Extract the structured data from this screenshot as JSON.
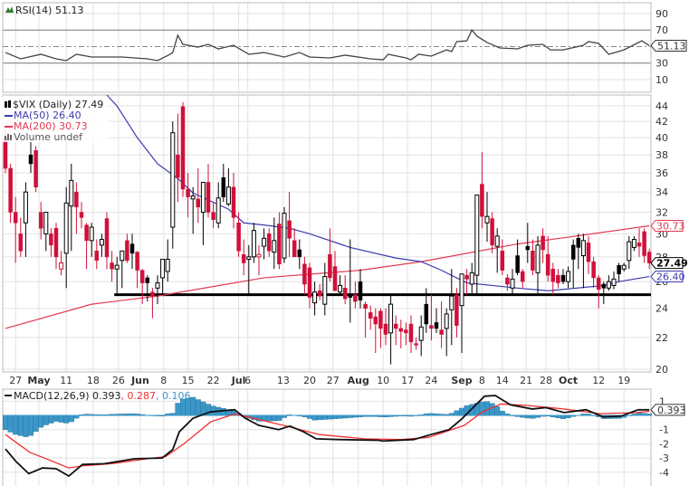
{
  "colors": {
    "down": "#d0103a",
    "up": "#000000",
    "ma50": "#3b3bb0",
    "ma200": "#e23a50",
    "hist": "#3a97c9",
    "macd": "#111111",
    "signal": "#f03030",
    "grid": "#e2e2e2"
  },
  "rsi": {
    "label": "RSI(14) 51.13",
    "badge": "51.13",
    "ticks": [
      "90",
      "70",
      "50",
      "30",
      "10"
    ]
  },
  "price": {
    "title": "$VIX (Daily) 27.49",
    "ma50_label": "MA(50) 26.40",
    "ma200_label": "MA(200) 30.73",
    "volume_label": "Volume undef",
    "badge_close": "27.49",
    "badge_ma50": "26.40",
    "badge_ma200": "30.73",
    "ticks": [
      "44",
      "42",
      "40",
      "38",
      "36",
      "34",
      "32",
      "30",
      "28",
      "26",
      "24",
      "22",
      "20"
    ]
  },
  "macd": {
    "label_main": "MACD(12,26,9) 0.393",
    "label_signal": ", 0.287",
    "label_hist": ", 0.106",
    "badge": "0.393",
    "ticks": [
      "1",
      "-1",
      "-2",
      "-3",
      "-4"
    ]
  },
  "x_labels": [
    {
      "t": "27",
      "i": 2
    },
    {
      "t": "May",
      "i": 6.6,
      "b": 1
    },
    {
      "t": "11",
      "i": 12
    },
    {
      "t": "18",
      "i": 17.3
    },
    {
      "t": "26",
      "i": 22.3
    },
    {
      "t": "Jun",
      "i": 26.6,
      "b": 1
    },
    {
      "t": "8",
      "i": 31.2
    },
    {
      "t": "15",
      "i": 36
    },
    {
      "t": "22",
      "i": 41
    },
    {
      "t": "Jul",
      "i": 46,
      "b": 1
    },
    {
      "t": "6",
      "i": 47.8
    },
    {
      "t": "13",
      "i": 54.8
    },
    {
      "t": "20",
      "i": 60
    },
    {
      "t": "27",
      "i": 64.6
    },
    {
      "t": "Aug",
      "i": 69.6,
      "b": 1
    },
    {
      "t": "10",
      "i": 74.5
    },
    {
      "t": "17",
      "i": 79.3
    },
    {
      "t": "24",
      "i": 84
    },
    {
      "t": "Sep",
      "i": 90,
      "b": 1
    },
    {
      "t": "8",
      "i": 94
    },
    {
      "t": "14",
      "i": 98
    },
    {
      "t": "21",
      "i": 102.7
    },
    {
      "t": "28",
      "i": 106.6
    },
    {
      "t": "Oct",
      "i": 111,
      "b": 1
    },
    {
      "t": "12",
      "i": 117
    },
    {
      "t": "19",
      "i": 122
    }
  ],
  "chart_data": {
    "type": "candlestick",
    "title": "$VIX (Daily)",
    "yscale": "log",
    "ylim": [
      20,
      44
    ],
    "support_level": {
      "value": 25.0,
      "from_index": 22
    },
    "ohlc": [
      [
        40,
        41,
        36,
        36.5
      ],
      [
        36.5,
        37,
        31,
        32
      ],
      [
        32,
        33.5,
        27.5,
        31
      ],
      [
        30,
        31.5,
        28,
        28.5
      ],
      [
        31,
        35,
        28,
        34
      ],
      [
        38,
        39.5,
        36,
        37
      ],
      [
        38.5,
        39,
        34,
        34.5
      ],
      [
        32,
        33,
        29.5,
        30.5
      ],
      [
        30,
        32,
        28.5,
        32
      ],
      [
        30,
        30.5,
        28,
        29
      ],
      [
        30.5,
        31,
        27,
        28
      ],
      [
        27,
        28.5,
        26.5,
        27.5
      ],
      [
        28.3,
        34.5,
        25.5,
        32.9
      ],
      [
        32.6,
        37,
        28.5,
        35.2
      ],
      [
        34,
        35,
        30,
        32.5
      ],
      [
        32,
        33,
        30.5,
        31.5
      ],
      [
        30.8,
        31,
        27,
        29.4
      ],
      [
        29.4,
        31,
        28,
        30.6
      ],
      [
        28.5,
        29.5,
        27,
        27.7
      ],
      [
        29,
        30,
        28,
        29.5
      ],
      [
        31.4,
        32,
        27,
        28
      ],
      [
        27.5,
        28.5,
        26,
        27
      ],
      [
        27,
        28,
        25,
        27.3
      ],
      [
        27.7,
        28,
        25.5,
        28.5
      ],
      [
        29.4,
        30,
        27.5,
        27.7
      ],
      [
        29.1,
        30,
        27,
        28.3
      ],
      [
        28.4,
        28.5,
        25.5,
        26.9
      ],
      [
        26.9,
        27,
        24.3,
        25.9
      ],
      [
        26.3,
        26.5,
        24.5,
        25.9
      ],
      [
        25.2,
        25.5,
        23.3,
        24.9
      ],
      [
        25.5,
        26.5,
        24.3,
        25.9
      ],
      [
        26.3,
        27.5,
        25,
        27.8
      ],
      [
        26.8,
        29.5,
        26,
        27.8
      ],
      [
        30.6,
        42,
        28.7,
        40.6
      ],
      [
        38,
        43,
        33,
        35.5
      ],
      [
        43.9,
        44.5,
        33.5,
        34.3
      ],
      [
        34.3,
        36,
        31.5,
        33.5
      ],
      [
        33.3,
        34.5,
        30,
        33.6
      ],
      [
        33.3,
        36.5,
        31,
        32.5
      ],
      [
        32,
        35,
        29,
        35
      ],
      [
        35,
        37,
        31.5,
        32
      ],
      [
        32,
        33,
        30.5,
        31.3
      ],
      [
        31,
        35,
        30.5,
        33.4
      ],
      [
        35.5,
        37,
        33,
        33.5
      ],
      [
        32.8,
        36.5,
        32.6,
        34.5
      ],
      [
        34.5,
        36,
        30.5,
        31.5
      ],
      [
        31,
        32,
        28,
        28.5
      ],
      [
        28.2,
        29.5,
        26.5,
        27.5
      ],
      [
        27.8,
        29,
        25,
        28
      ],
      [
        28,
        31,
        27.5,
        30.3
      ],
      [
        28,
        29,
        26.5,
        28.2
      ],
      [
        28.9,
        30.5,
        27.8,
        29.6
      ],
      [
        30,
        30.5,
        28,
        28.5
      ],
      [
        28.4,
        31.5,
        27,
        29.4
      ],
      [
        30.9,
        32,
        27,
        27.4
      ],
      [
        27.9,
        32.5,
        27.5,
        31.9
      ],
      [
        31.2,
        34,
        28,
        29.6
      ],
      [
        29.4,
        30.5,
        28,
        28
      ],
      [
        28.6,
        29.5,
        27,
        28
      ],
      [
        27.4,
        28,
        25,
        25.8
      ],
      [
        27.1,
        27.5,
        24,
        24.8
      ],
      [
        24.4,
        26,
        23.5,
        25.2
      ],
      [
        25.3,
        25.8,
        24.6,
        24.9
      ],
      [
        24.3,
        27.5,
        23.5,
        26.4
      ],
      [
        28.2,
        30.5,
        26,
        26.3
      ],
      [
        27.2,
        28.5,
        25.5,
        25.3
      ],
      [
        25.2,
        26.5,
        25,
        25.7
      ],
      [
        25.5,
        26.5,
        24.3,
        24.7
      ],
      [
        25,
        29.5,
        23,
        24.8
      ],
      [
        25,
        26,
        24,
        24.5
      ],
      [
        26,
        27,
        24,
        24.6
      ],
      [
        24.3,
        24.5,
        22,
        24
      ],
      [
        23.7,
        24.2,
        22.5,
        23.3
      ],
      [
        23.4,
        24,
        21,
        22.9
      ],
      [
        23.8,
        24,
        21.3,
        22.6
      ],
      [
        22.9,
        24,
        21.5,
        22.2
      ],
      [
        22.3,
        25,
        20.3,
        24.3
      ],
      [
        22.9,
        23.5,
        21.5,
        22.6
      ],
      [
        22.6,
        23.2,
        21.3,
        22.4
      ],
      [
        22.5,
        23,
        21.5,
        22.3
      ],
      [
        22.9,
        23.5,
        21,
        21.7
      ],
      [
        21.6,
        22,
        21.2,
        21.5
      ],
      [
        21.8,
        23.5,
        20.8,
        22.7
      ],
      [
        24.3,
        25.5,
        22.3,
        22.9
      ],
      [
        22.8,
        25,
        21.8,
        22.6
      ],
      [
        23,
        24,
        22.3,
        22.6
      ],
      [
        22.5,
        24.5,
        21.3,
        22.2
      ],
      [
        22.6,
        24,
        20.8,
        23.6
      ],
      [
        23.9,
        27,
        21.5,
        24.9
      ],
      [
        25,
        25.5,
        22,
        22.8
      ],
      [
        24.2,
        26,
        21,
        26.6
      ],
      [
        26.5,
        27,
        25,
        26.2
      ],
      [
        25.8,
        27.5,
        25,
        26.7
      ],
      [
        26.5,
        33,
        25,
        33.7
      ],
      [
        34.8,
        38.3,
        30.5,
        31.6
      ],
      [
        31,
        34,
        29.3,
        31.6
      ],
      [
        31.4,
        32,
        28.3,
        29
      ],
      [
        28.9,
        30.5,
        26.7,
        29.8
      ],
      [
        28.5,
        29.5,
        26.5,
        26.9
      ],
      [
        26.3,
        26.6,
        25.3,
        25.8
      ],
      [
        25.5,
        27,
        25,
        26.2
      ],
      [
        28.1,
        29.5,
        26.5,
        26.7
      ],
      [
        26.8,
        27,
        25.5,
        26
      ],
      [
        28.9,
        31,
        27.5,
        28.6
      ],
      [
        28.5,
        29.5,
        26.5,
        26.9
      ],
      [
        26.7,
        29.8,
        25,
        29
      ],
      [
        29.8,
        30.5,
        27.5,
        28.6
      ],
      [
        28.2,
        29.8,
        26,
        26.5
      ],
      [
        27,
        27.5,
        25,
        26
      ],
      [
        26.5,
        27,
        25.5,
        25.9
      ],
      [
        26.5,
        27,
        25.8,
        26
      ],
      [
        26,
        27.2,
        25.5,
        26.8
      ],
      [
        29,
        29.5,
        25.5,
        27.8
      ],
      [
        29.6,
        30,
        27,
        28.8
      ],
      [
        28.1,
        30,
        25.5,
        29.4
      ],
      [
        29.2,
        29.8,
        26.6,
        27.6
      ],
      [
        27.6,
        28,
        25.5,
        26.3
      ],
      [
        26.3,
        26.5,
        24,
        25.4
      ],
      [
        25.8,
        26,
        24.3,
        25.5
      ],
      [
        25.5,
        26.5,
        25.3,
        26
      ],
      [
        25.7,
        26.8,
        25.4,
        26.2
      ],
      [
        27.3,
        27.5,
        26,
        26.6
      ],
      [
        27,
        27.5,
        26.8,
        27.3
      ],
      [
        27.7,
        29.8,
        27,
        29.3
      ],
      [
        28.8,
        29.8,
        28.5,
        29.5
      ],
      [
        29.2,
        30.5,
        28,
        28.9
      ],
      [
        30.2,
        30.5,
        27.5,
        28.1
      ],
      [
        28.4,
        28.7,
        27,
        27.49
      ]
    ],
    "ma50": [
      [
        20,
        46
      ],
      [
        22,
        44
      ],
      [
        26,
        40
      ],
      [
        30,
        37
      ],
      [
        34,
        35.4
      ],
      [
        37,
        33.9
      ],
      [
        44,
        32.3
      ],
      [
        47,
        31
      ],
      [
        51,
        30.8
      ],
      [
        56,
        30.5
      ],
      [
        60,
        30
      ],
      [
        68,
        28.8
      ],
      [
        77,
        27.9
      ],
      [
        82,
        27.6
      ],
      [
        86,
        26.9
      ],
      [
        91,
        25.9
      ],
      [
        96,
        25.7
      ],
      [
        101,
        25.5
      ],
      [
        107,
        25.3
      ],
      [
        110,
        25.4
      ],
      [
        118,
        25.7
      ],
      [
        121,
        26
      ],
      [
        127,
        26.4
      ]
    ],
    "ma200": [
      [
        0,
        22.6
      ],
      [
        17,
        24.3
      ],
      [
        30,
        24.9
      ],
      [
        51,
        26.3
      ],
      [
        70,
        26.9
      ],
      [
        82,
        27.6
      ],
      [
        101,
        29.1
      ],
      [
        111,
        29.7
      ],
      [
        127,
        30.73
      ]
    ],
    "rsi": [
      [
        0,
        42.8
      ],
      [
        3,
        35.2
      ],
      [
        7,
        40.7
      ],
      [
        10,
        35.2
      ],
      [
        12,
        33
      ],
      [
        14,
        40.7
      ],
      [
        17,
        37.4
      ],
      [
        23,
        37.4
      ],
      [
        28,
        35.2
      ],
      [
        30,
        33
      ],
      [
        32.5,
        40.7
      ],
      [
        33,
        42.8
      ],
      [
        34,
        63.7
      ],
      [
        35,
        52.7
      ],
      [
        38,
        49.4
      ],
      [
        40,
        52.7
      ],
      [
        42,
        47.2
      ],
      [
        45,
        51.6
      ],
      [
        48,
        40.7
      ],
      [
        51,
        42.8
      ],
      [
        55,
        37.4
      ],
      [
        58,
        42.8
      ],
      [
        60,
        37.4
      ],
      [
        64,
        36.3
      ],
      [
        67,
        39.6
      ],
      [
        72,
        35.2
      ],
      [
        74.5,
        34
      ],
      [
        75.5,
        40.7
      ],
      [
        79,
        36.3
      ],
      [
        80,
        34
      ],
      [
        81.5,
        40.7
      ],
      [
        84,
        38.5
      ],
      [
        87,
        46
      ],
      [
        88,
        44
      ],
      [
        89,
        56
      ],
      [
        91,
        57
      ],
      [
        92,
        70.2
      ],
      [
        93,
        62.6
      ],
      [
        95,
        55
      ],
      [
        97.5,
        48.3
      ],
      [
        101,
        47.2
      ],
      [
        103,
        51.6
      ],
      [
        106,
        52.7
      ],
      [
        107.5,
        46
      ],
      [
        110,
        46
      ],
      [
        114,
        51.6
      ],
      [
        115,
        56
      ],
      [
        117,
        53.8
      ],
      [
        119,
        40.7
      ],
      [
        122,
        46
      ],
      [
        124.5,
        53.8
      ],
      [
        125.5,
        57
      ],
      [
        127,
        51.13
      ]
    ],
    "macd_line": [
      [
        0,
        -2.36
      ],
      [
        2.1,
        -3.25
      ],
      [
        4.6,
        -4.1
      ],
      [
        7.3,
        -3.7
      ],
      [
        10,
        -3.75
      ],
      [
        12.5,
        -4.27
      ],
      [
        15.2,
        -3.45
      ],
      [
        19.5,
        -3.4
      ],
      [
        25.5,
        -3.05
      ],
      [
        30.9,
        -3.0
      ],
      [
        33,
        -2.4
      ],
      [
        34.3,
        -1.15
      ],
      [
        37,
        -0.2
      ],
      [
        40.4,
        0.25
      ],
      [
        45.2,
        0.4
      ],
      [
        47.3,
        -0.2
      ],
      [
        50,
        -0.7
      ],
      [
        53.9,
        -1.0
      ],
      [
        56.1,
        -0.75
      ],
      [
        58.8,
        -1.15
      ],
      [
        61.3,
        -1.65
      ],
      [
        65.7,
        -1.7
      ],
      [
        73.6,
        -1.75
      ],
      [
        74.5,
        -1.8
      ],
      [
        80.5,
        -1.7
      ],
      [
        83.9,
        -1.35
      ],
      [
        87.5,
        -1.0
      ],
      [
        90,
        -0.25
      ],
      [
        91.8,
        0.4
      ],
      [
        94.5,
        1.35
      ],
      [
        96.6,
        1.4
      ],
      [
        99.6,
        0.75
      ],
      [
        103.9,
        0.45
      ],
      [
        106.6,
        0.55
      ],
      [
        110.2,
        0.2
      ],
      [
        114.5,
        0.4
      ],
      [
        117.9,
        -0.1
      ],
      [
        121.4,
        -0.05
      ],
      [
        124.8,
        0.4
      ],
      [
        127,
        0.393
      ]
    ],
    "signal_line": [
      [
        0,
        -1.35
      ],
      [
        4.8,
        -2.6
      ],
      [
        8.4,
        -3.1
      ],
      [
        12.5,
        -3.7
      ],
      [
        15.2,
        -3.55
      ],
      [
        20.9,
        -3.4
      ],
      [
        28,
        -3.05
      ],
      [
        31.6,
        -2.9
      ],
      [
        35.2,
        -2.0
      ],
      [
        40.5,
        -0.45
      ],
      [
        45.2,
        0.1
      ],
      [
        49.5,
        -0.25
      ],
      [
        54.8,
        -0.7
      ],
      [
        62,
        -1.35
      ],
      [
        70.9,
        -1.65
      ],
      [
        78,
        -1.7
      ],
      [
        83.4,
        -1.55
      ],
      [
        90.5,
        -0.7
      ],
      [
        94.1,
        0.25
      ],
      [
        97.7,
        0.8
      ],
      [
        103,
        0.7
      ],
      [
        110.2,
        0.45
      ],
      [
        117.3,
        0.12
      ],
      [
        124.5,
        0.2
      ],
      [
        127,
        0.287
      ]
    ]
  }
}
